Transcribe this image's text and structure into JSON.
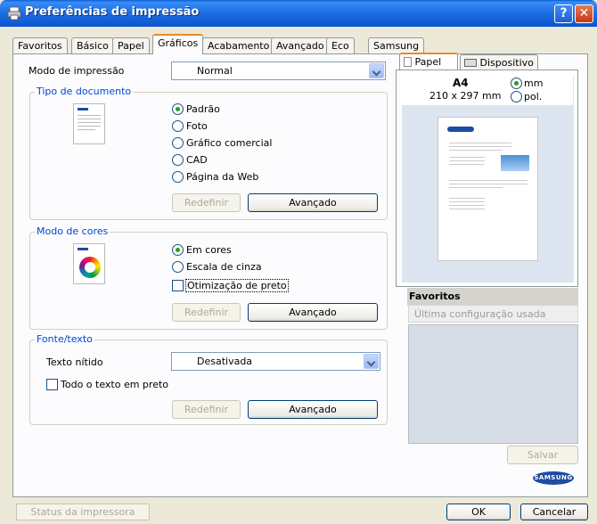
{
  "window": {
    "title": "Preferências de impressão"
  },
  "tabs": [
    "Favoritos",
    "Básico",
    "Papel",
    "Gráficos",
    "Acabamento",
    "Avançado",
    "Eco",
    "Samsung"
  ],
  "print_mode": {
    "label": "Modo de impressão",
    "value": "Normal"
  },
  "doc_type": {
    "legend": "Tipo de documento",
    "options": [
      "Padrão",
      "Foto",
      "Gráfico comercial",
      "CAD",
      "Página da Web"
    ],
    "reset": "Redefinir",
    "advanced": "Avançado"
  },
  "color_mode": {
    "legend": "Modo de cores",
    "options": [
      "Em cores",
      "Escala de cinza"
    ],
    "black_opt": "Otimização de preto",
    "reset": "Redefinir",
    "advanced": "Avançado"
  },
  "font_text": {
    "legend": "Fonte/texto",
    "sharp_label": "Texto nítido",
    "sharp_value": "Desativada",
    "all_black": "Todo o texto em preto",
    "reset": "Redefinir",
    "advanced": "Avançado"
  },
  "right": {
    "tab_paper": "Papel",
    "tab_device": "Dispositivo",
    "size_name": "A4",
    "size_dims": "210 x 297 mm",
    "unit_mm": "mm",
    "unit_pol": "pol.",
    "favorites": "Favoritos",
    "fav_placeholder": "Última configuração usada",
    "save": "Salvar",
    "logo": "SAMSUNG"
  },
  "footer": {
    "status": "Status da impressora",
    "ok": "OK",
    "cancel": "Cancelar"
  }
}
